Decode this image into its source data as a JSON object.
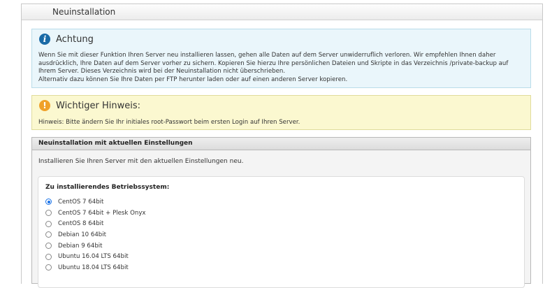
{
  "window": {
    "title": "Neuinstallation"
  },
  "notice": {
    "title": "Achtung",
    "line1": "Wenn Sie mit dieser Funktion Ihren Server neu installieren lassen, gehen alle Daten auf dem Server unwiderruflich verloren. Wir empfehlen Ihnen daher ausdrücklich, Ihre Daten auf dem Server vorher zu sichern. Kopieren Sie hierzu Ihre persönlichen Dateien und Skripte in das Verzeichnis /private-backup auf Ihrem Server. Dieses Verzeichnis wird bei der Neuinstallation nicht überschrieben.",
    "line2": "Alternativ dazu können Sie Ihre Daten per FTP herunter laden oder auf einen anderen Server kopieren."
  },
  "hint": {
    "title": "Wichtiger Hinweis:",
    "text": "Hinweis: Bitte ändern Sie Ihr initiales root-Passwort beim ersten Login auf Ihren Server."
  },
  "section": {
    "title": "Neuinstallation mit aktuellen Einstellungen",
    "description": "Installieren Sie Ihren Server mit den aktuellen Einstellungen neu.",
    "os_label": "Zu installierendes Betriebssystem:",
    "os_options": [
      "CentOS 7 64bit",
      "CentOS 7 64bit + Plesk Onyx",
      "CentOS 8 64bit",
      "Debian 10 64bit",
      "Debian 9 64bit",
      "Ubuntu 16.04 LTS 64bit",
      "Ubuntu 18.04 LTS 64bit"
    ],
    "selected_os": "CentOS 7 64bit"
  },
  "colors": {
    "accent": "#1a73e8",
    "info_bg": "#eaf6fb",
    "hint_bg": "#fbf8d0",
    "info_icon": "#1a6aa6",
    "warn_icon": "#f0a12a"
  },
  "icons": {
    "logo": "app-logo-icon",
    "notice": "info-icon",
    "hint": "warning-icon"
  }
}
